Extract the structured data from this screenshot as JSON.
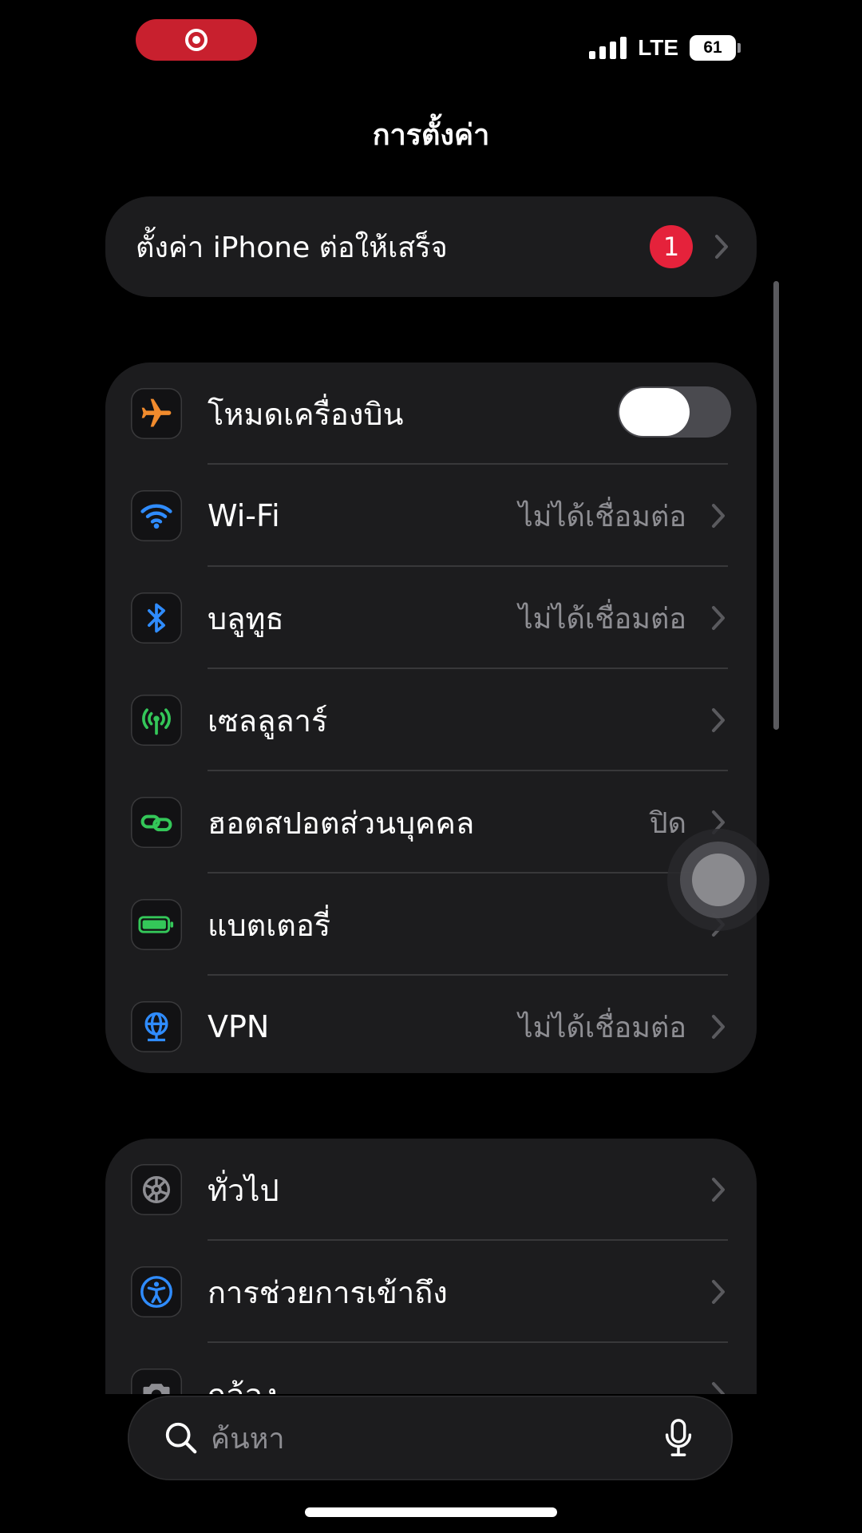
{
  "status_bar": {
    "network": "LTE",
    "battery_percent": "61",
    "signal_bars": 4
  },
  "header": {
    "title": "การตั้งค่า"
  },
  "setup_banner": {
    "label": "ตั้งค่า iPhone ต่อให้เสร็จ",
    "badge_count": "1"
  },
  "connectivity": {
    "airplane": {
      "label": "โหมดเครื่องบิน",
      "enabled": false,
      "icon": "airplane-icon",
      "color": "#f18b2d"
    },
    "wifi": {
      "label": "Wi-Fi",
      "value": "ไม่ได้เชื่อมต่อ",
      "icon": "wifi-icon",
      "color": "#2f8cff"
    },
    "bluetooth": {
      "label": "บลูทูธ",
      "value": "ไม่ได้เชื่อมต่อ",
      "icon": "bluetooth-icon",
      "color": "#2f8cff"
    },
    "cellular": {
      "label": "เซลลูลาร์",
      "icon": "antenna-icon",
      "color": "#34c759"
    },
    "hotspot": {
      "label": "ฮอตสปอตส่วนบุคคล",
      "value": "ปิด",
      "icon": "link-icon",
      "color": "#34c759"
    },
    "battery": {
      "label": "แบตเตอรี่",
      "icon": "battery-icon",
      "color": "#34c759"
    },
    "vpn": {
      "label": "VPN",
      "value": "ไม่ได้เชื่อมต่อ",
      "icon": "globe-icon",
      "color": "#2f8cff"
    }
  },
  "system": {
    "general": {
      "label": "ทั่วไป",
      "icon": "gear-icon",
      "color": "#8e8e93"
    },
    "accessibility": {
      "label": "การช่วยการเข้าถึง",
      "icon": "accessibility-icon",
      "color": "#2f8cff"
    },
    "camera": {
      "label": "กล้อง",
      "icon": "camera-icon",
      "color": "#8e8e93"
    }
  },
  "search": {
    "placeholder": "ค้นหา"
  }
}
